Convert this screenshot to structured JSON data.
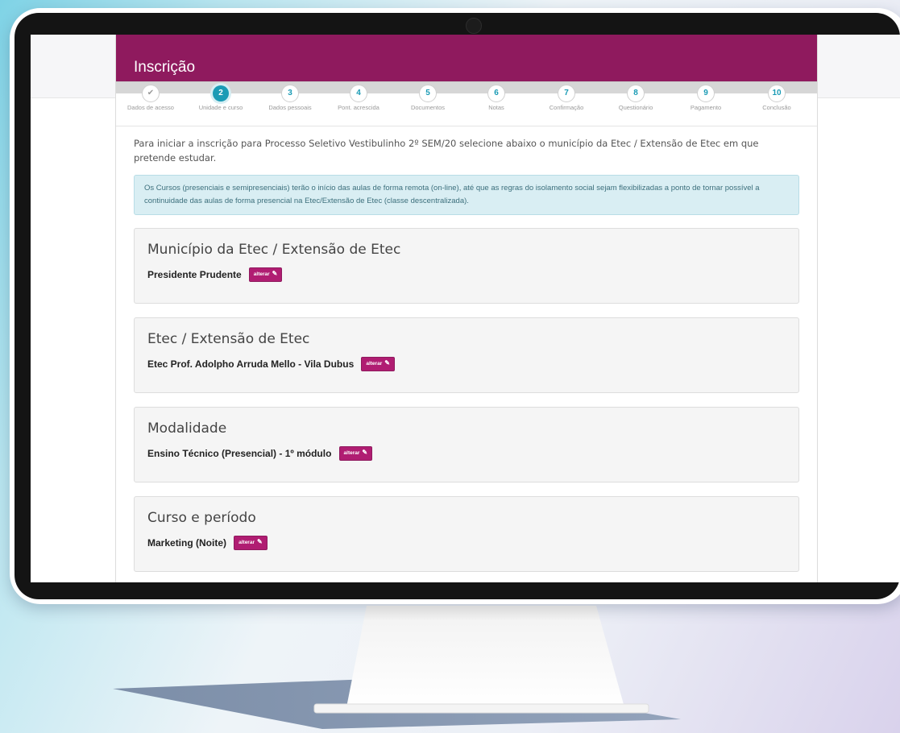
{
  "page": {
    "title": "Inscrição",
    "steps": [
      {
        "label": "Dados de acesso",
        "number": "✔",
        "state": "done"
      },
      {
        "label": "Unidade e curso",
        "number": "2",
        "state": "active"
      },
      {
        "label": "Dados pessoais",
        "number": "3",
        "state": "pending"
      },
      {
        "label": "Pont. acrescida",
        "number": "4",
        "state": "pending"
      },
      {
        "label": "Documentos",
        "number": "5",
        "state": "pending"
      },
      {
        "label": "Notas",
        "number": "6",
        "state": "pending"
      },
      {
        "label": "Confirmação",
        "number": "7",
        "state": "pending"
      },
      {
        "label": "Questionário",
        "number": "8",
        "state": "pending"
      },
      {
        "label": "Pagamento",
        "number": "9",
        "state": "pending"
      },
      {
        "label": "Conclusão",
        "number": "10",
        "state": "pending"
      }
    ],
    "intro": "Para iniciar a inscrição para Processo Seletivo Vestibulinho 2º SEM/20 selecione abaixo o município da Etec / Extensão de Etec em que pretende estudar.",
    "notice": "Os Cursos (presenciais e semipresenciais) terão o início das aulas de forma remota (on-line), até que as regras do isolamento social sejam flexibilizadas a ponto de tornar possível a continuidade das aulas de forma presencial na Etec/Extensão de Etec (classe descentralizada).",
    "edit_label": "alterar",
    "sections": [
      {
        "title": "Município da Etec / Extensão de Etec",
        "value": "Presidente Prudente"
      },
      {
        "title": "Etec / Extensão de Etec",
        "value": "Etec Prof. Adolpho Arruda Mello - Vila Dubus"
      },
      {
        "title": "Modalidade",
        "value": "Ensino Técnico (Presencial) - 1º módulo"
      },
      {
        "title": "Curso e período",
        "value": "Marketing (Noite)"
      }
    ]
  },
  "colors": {
    "brand": "#8f1a5e",
    "accent": "#1a9bb5",
    "notice_bg": "#d9eef3"
  }
}
